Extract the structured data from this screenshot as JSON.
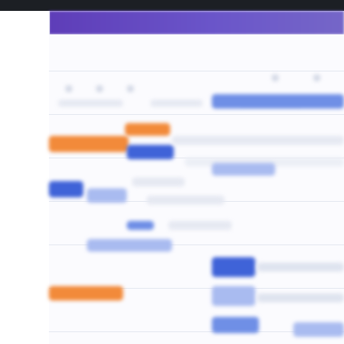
{
  "app": {
    "title": ""
  },
  "colors": {
    "topbar": "#1c1f24",
    "header": "#6a55c9",
    "accent_orange": "#f28a3a",
    "accent_blue": "#3f63d8",
    "soft_blue": "#a9bbf0"
  },
  "icons": {
    "menu": "menu-icon"
  }
}
